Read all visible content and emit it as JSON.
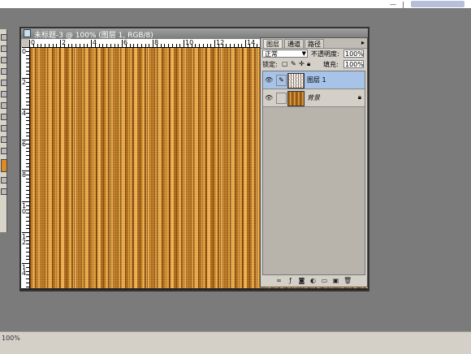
{
  "document": {
    "title": "未标题-3 @ 100% (图层 1, RGB/8)",
    "ruler_h_labels": [
      "0",
      "2",
      "4",
      "6",
      "8",
      "10",
      "12",
      "14",
      "16"
    ],
    "ruler_v_labels": [
      "0",
      "2",
      "4",
      "6",
      "8",
      "1\n0",
      "1\n2",
      "1\n4",
      "1\n6"
    ]
  },
  "layers_panel": {
    "tabs": [
      "图层",
      "通道",
      "路径"
    ],
    "blend_mode": "正常",
    "opacity_label": "不透明度:",
    "opacity_value": "100%",
    "lock_label": "锁定:",
    "fill_label": "填充:",
    "fill_value": "100%",
    "layers": [
      {
        "name": "图层 1",
        "selected": true
      },
      {
        "name": "背景",
        "selected": false,
        "locked": true
      }
    ]
  },
  "status": {
    "zoom": "100%"
  },
  "colors": {
    "wood_light": "#d99836",
    "wood_dark": "#8f5512",
    "selection": "#a7c3e8"
  }
}
